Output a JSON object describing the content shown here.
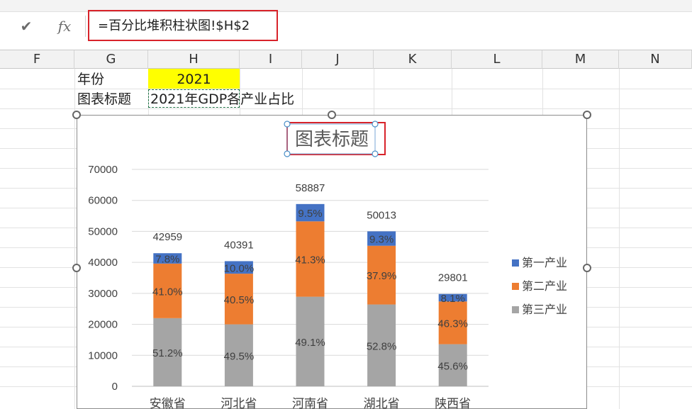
{
  "formula_bar": {
    "check_icon": "✔",
    "fx_label": "fx",
    "formula": "=百分比堆积柱状图!$H$2"
  },
  "columns": [
    "F",
    "G",
    "H",
    "I",
    "J",
    "K",
    "L",
    "M",
    "N"
  ],
  "cells": {
    "g1": "年份",
    "h1": "2021",
    "g2": "图表标题",
    "h2": "2021年GDP各产业占比"
  },
  "colors": {
    "highlight": "#ffff00",
    "selection_border": "#d8232a",
    "series_primary": "#4472c4",
    "series_secondary": "#ed7d31",
    "series_tertiary": "#a5a5a5"
  },
  "chart_data": {
    "type": "bar",
    "stacked": true,
    "title": "图表标题",
    "categories": [
      "安徽省",
      "河北省",
      "河南省",
      "湖北省",
      "陕西省"
    ],
    "series": [
      {
        "name": "第三产业",
        "values": [
          21993,
          19993,
          28913,
          26407,
          13589
        ],
        "labels": [
          "51.2%",
          "49.5%",
          "49.1%",
          "52.8%",
          "45.6%"
        ]
      },
      {
        "name": "第二产业",
        "values": [
          17613,
          16358,
          24320,
          18955,
          13798
        ],
        "labels": [
          "41.0%",
          "40.5%",
          "41.3%",
          "37.9%",
          "46.3%"
        ]
      },
      {
        "name": "第一产业",
        "values": [
          3351,
          4039,
          5594,
          4651,
          2414
        ],
        "labels": [
          "7.8%",
          "10.0%",
          "9.5%",
          "9.3%",
          "8.1%"
        ]
      }
    ],
    "totals": [
      42959,
      40391,
      58887,
      50013,
      29801
    ],
    "yticks": [
      0,
      10000,
      20000,
      30000,
      40000,
      50000,
      60000,
      70000
    ],
    "ylim": [
      0,
      70000
    ],
    "legend": [
      "第一产业",
      "第二产业",
      "第三产业"
    ],
    "legend_position": "right",
    "grid": true
  }
}
